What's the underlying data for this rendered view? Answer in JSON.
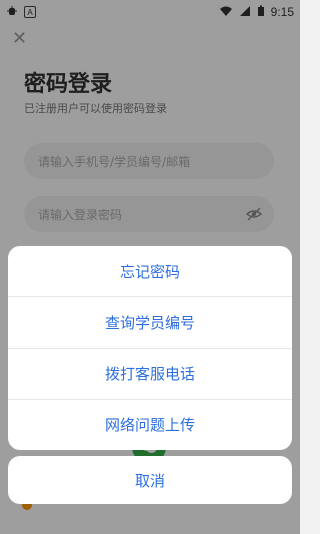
{
  "statusbar": {
    "time": "9:15",
    "left_icons": [
      "bug-icon",
      "a-icon"
    ],
    "right_icons": [
      "wifi-icon",
      "signal-icon",
      "battery-icon"
    ]
  },
  "page": {
    "close_icon": "close-icon",
    "title": "密码登录",
    "subtitle": "已注册用户可以使用密码登录",
    "inputs": {
      "phone_placeholder": "请输入手机号/学员编号/邮箱",
      "password_placeholder": "请输入登录密码",
      "password_toggle_icon": "eye-off-icon"
    },
    "wechat_icon": "wechat-icon"
  },
  "action_sheet": {
    "items": [
      {
        "label": "忘记密码"
      },
      {
        "label": "查询学员编号"
      },
      {
        "label": "拨打客服电话"
      },
      {
        "label": "网络问题上传"
      }
    ],
    "cancel_label": "取消"
  },
  "colors": {
    "accent": "#2d6fe0",
    "overlay": "rgba(0,0,0,0.38)",
    "wechat": "#36b14b"
  }
}
